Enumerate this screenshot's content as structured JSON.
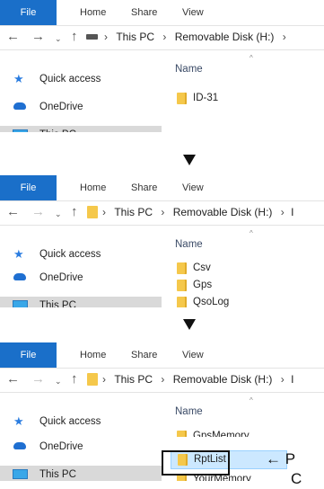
{
  "ribbon": {
    "file": "File",
    "home": "Home",
    "share": "Share",
    "view": "View"
  },
  "nav": {
    "back": "←",
    "forward": "→",
    "recent": "⌄",
    "up": "↑"
  },
  "sidebar": {
    "quick_access": "Quick access",
    "onedrive": "OneDrive",
    "this_pc": "This PC"
  },
  "content": {
    "column_name": "Name",
    "sort_caret": "^"
  },
  "panels": [
    {
      "breadcrumb": {
        "sep1": "›",
        "this_pc": "This PC",
        "sep2": "›",
        "drive": "Removable Disk (H:)",
        "sep3": "›"
      },
      "items": [
        "ID-31"
      ]
    },
    {
      "breadcrumb": {
        "sep1": "›",
        "this_pc": "This PC",
        "sep2": "›",
        "drive": "Removable Disk (H:)",
        "sep3": "›",
        "trail": "I"
      },
      "items": [
        "Csv",
        "Gps",
        "QsoLog"
      ]
    },
    {
      "breadcrumb": {
        "sep1": "›",
        "this_pc": "This PC",
        "sep2": "›",
        "drive": "Removable Disk (H:)",
        "sep3": "›",
        "trail": "I"
      },
      "items": [
        "GpsMemory",
        "RptList",
        "YourMemory"
      ],
      "selected": "RptList"
    }
  ],
  "step_arrow": "▼",
  "callout": {
    "line1": "← P",
    "line2": "C"
  }
}
